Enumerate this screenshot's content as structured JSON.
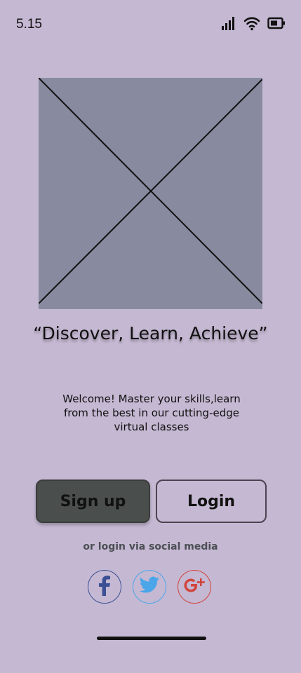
{
  "status_bar": {
    "time": "5.15",
    "icons": [
      "signal-icon",
      "wifi-icon",
      "battery-icon"
    ]
  },
  "hero": {
    "image": "placeholder-image-icon"
  },
  "tagline": "“Discover, Learn, Achieve”",
  "welcome_text": "Welcome! Master your skills,learn from the best in our cutting-edge virtual classes",
  "buttons": {
    "signup_label": "Sign up",
    "login_label": "Login"
  },
  "social": {
    "label": "or login via social media",
    "providers": [
      "facebook-icon",
      "twitter-icon",
      "google-plus-icon"
    ]
  },
  "colors": {
    "background": "#c5b8d2",
    "placeholder": "#888b9f",
    "signup_bg": "#4a4e4c",
    "facebook": "#3b4f95",
    "twitter": "#4aa6e8",
    "google_plus": "#d1453c"
  }
}
